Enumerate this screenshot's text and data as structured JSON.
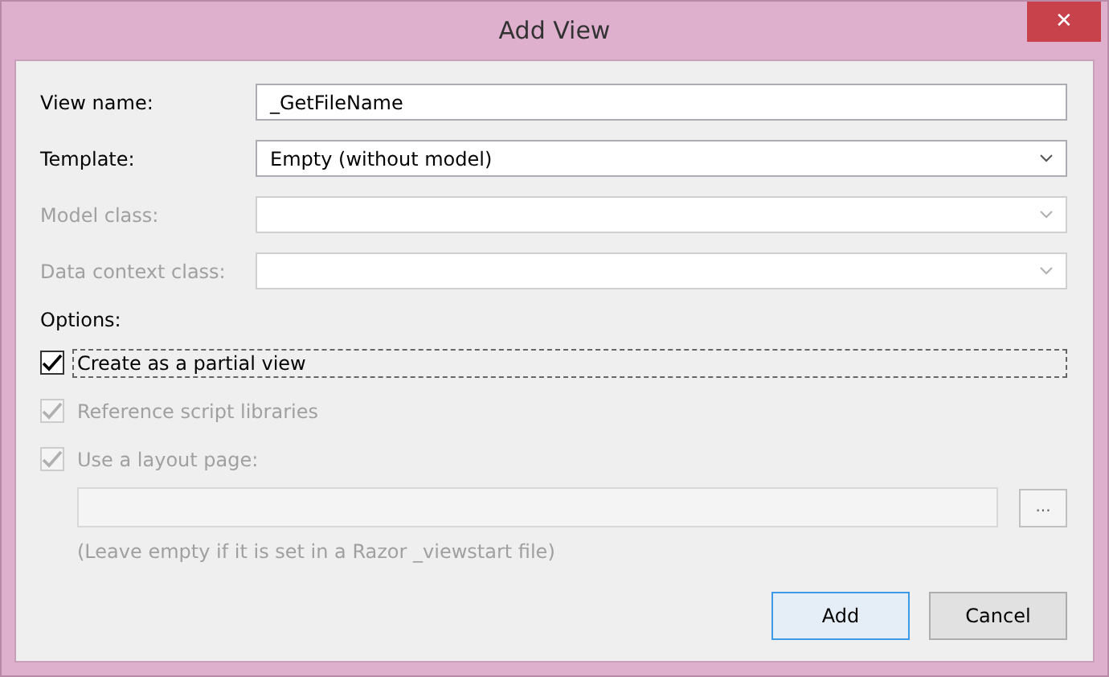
{
  "window": {
    "title": "Add View",
    "close_glyph": "✕"
  },
  "fields": [
    {
      "label": "View name:",
      "kind": "text",
      "value": "_GetFileName",
      "disabled": false
    },
    {
      "label": "Template:",
      "kind": "select",
      "value": "Empty (without model)",
      "disabled": false
    },
    {
      "label": "Model class:",
      "kind": "select",
      "disabled": true
    },
    {
      "label": "Data context class:",
      "kind": "select",
      "disabled": true
    }
  ],
  "options_label": "Options:",
  "options": [
    {
      "label": "Create as a partial view",
      "checked": true,
      "disabled": false,
      "focused": true
    },
    {
      "label": "Reference script libraries",
      "checked": true,
      "disabled": true,
      "focused": false
    },
    {
      "label": "Use a layout page:",
      "checked": true,
      "disabled": true,
      "focused": false
    }
  ],
  "layout_page": {
    "disabled": true,
    "browse": "...",
    "hint": "(Leave empty if it is set in a Razor _viewstart file)"
  },
  "buttons": [
    {
      "label": "Add",
      "default": true
    },
    {
      "label": "Cancel",
      "default": false
    }
  ]
}
